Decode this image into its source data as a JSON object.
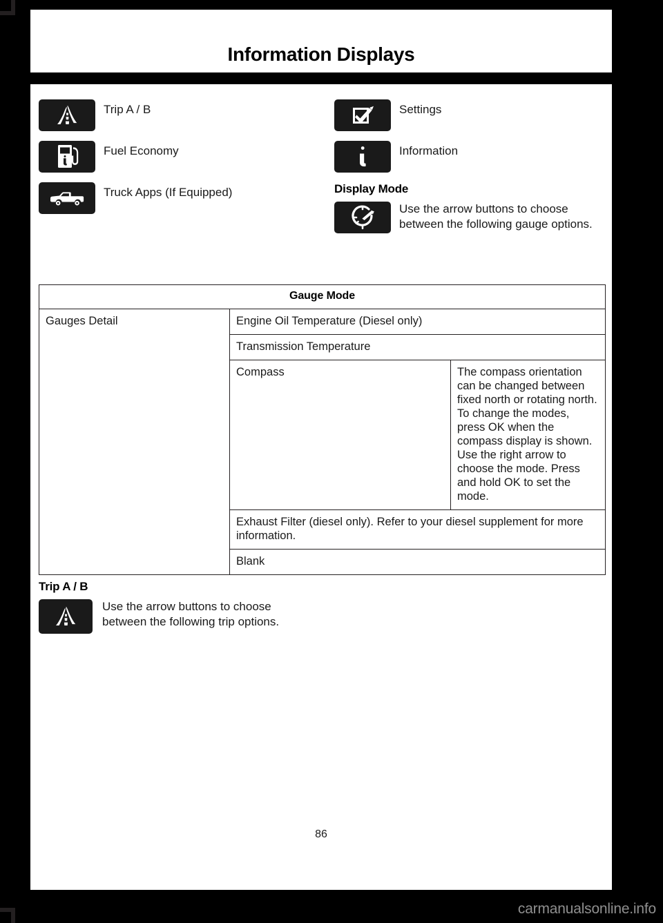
{
  "page": {
    "title": "Information Displays",
    "number": "86",
    "watermark": "carmanualsonline.info"
  },
  "left_column": {
    "items": [
      {
        "icon": "road-trip-icon",
        "label": "Trip A / B"
      },
      {
        "icon": "fuel-pump-information-icon",
        "label": "Fuel Economy"
      },
      {
        "icon": "pickup-truck-icon",
        "label": "Truck Apps (If Equipped)"
      }
    ]
  },
  "right_column": {
    "items": [
      {
        "icon": "checkbox-pen-settings-icon",
        "label": "Settings"
      },
      {
        "icon": "information-i-icon",
        "label": "Information"
      }
    ],
    "display_mode": {
      "heading": "Display Mode",
      "icon": "gauge-speedometer-icon",
      "text": "Use the arrow buttons to choose between the following gauge options."
    }
  },
  "gauge_table": {
    "header": "Gauge Mode",
    "row_label": "Gauges Detail",
    "rows": [
      {
        "option": "Engine Oil Temperature (Diesel only)",
        "note": ""
      },
      {
        "option": "Transmission Temperature",
        "note": ""
      },
      {
        "option": "Compass",
        "note": "The compass orientation can be changed between fixed north or rotating north. To change the modes, press OK when the compass display is shown. Use the right arrow to choose the mode. Press and hold OK to set the mode."
      },
      {
        "option": "Exhaust Filter (diesel only). Refer to your diesel supplement for more information.",
        "note": ""
      },
      {
        "option": "Blank",
        "note": ""
      }
    ]
  },
  "trip_section": {
    "heading": "Trip A / B",
    "icon": "road-trip-icon",
    "text": "Use the arrow buttons to choose between the following trip options."
  }
}
